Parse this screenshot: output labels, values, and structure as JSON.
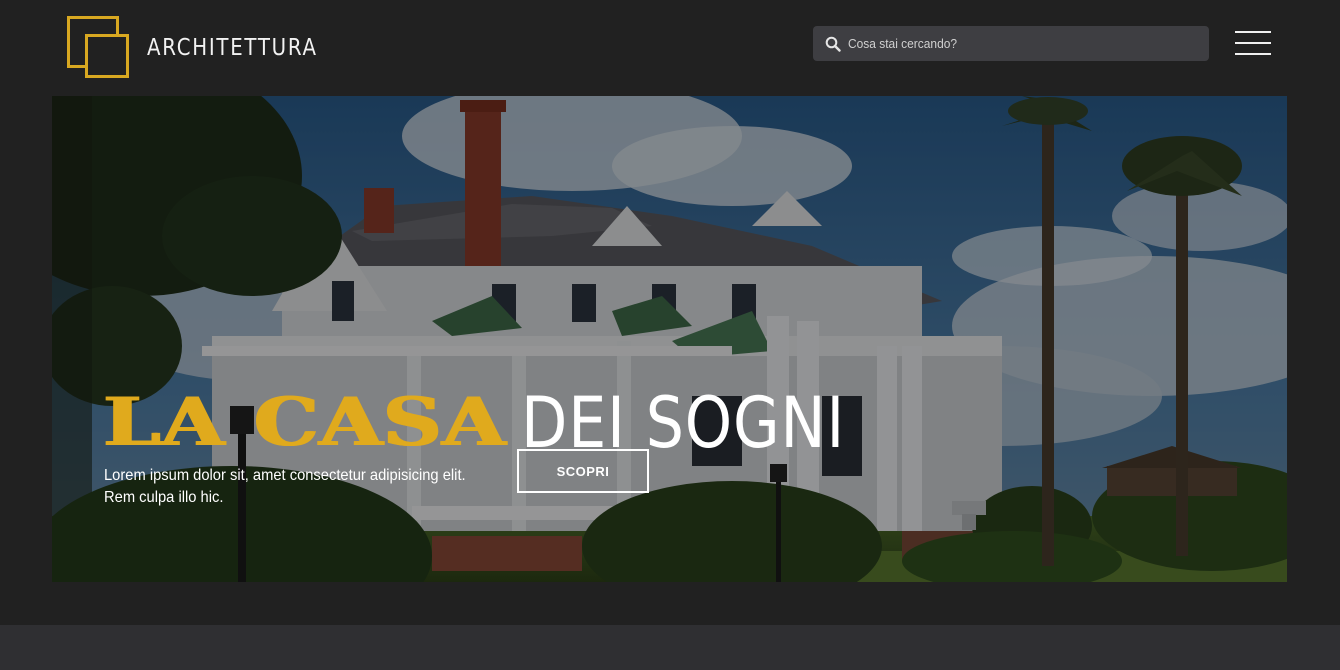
{
  "header": {
    "logo_text": "ARCHITETTURA",
    "search": {
      "placeholder": "Cosa stai cercando?",
      "icon": "search-icon"
    },
    "menu_icon": "hamburger-menu-icon"
  },
  "hero": {
    "title_accent": "LA CASA",
    "title_rest": "DEI SOGNI",
    "description": "Lorem ipsum dolor sit, amet consectetur adipisicing elit. Rem culpa illo hic.",
    "cta_label": "SCOPRI",
    "image": "victorian-house-photo"
  },
  "colors": {
    "background": "#212121",
    "accent": "#e0aa1d",
    "search_bg": "#3e3e42",
    "footer_band": "#2f2f32"
  }
}
